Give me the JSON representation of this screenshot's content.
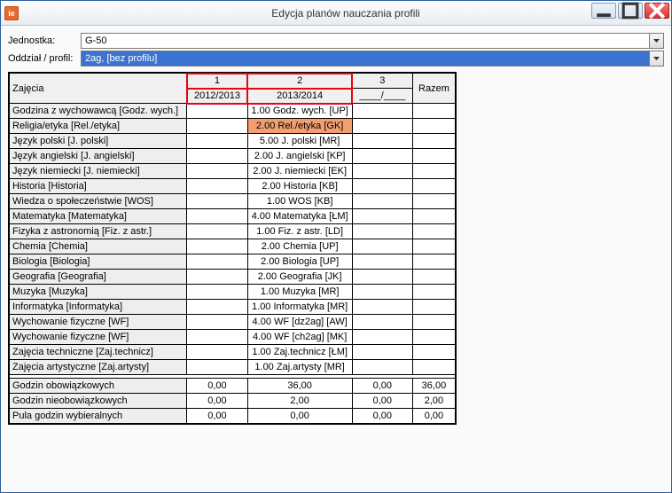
{
  "window": {
    "title": "Edycja planów nauczania profili",
    "icon_glyph": "ie"
  },
  "form": {
    "unit_label": "Jednostka:",
    "unit_value": "G-50",
    "profile_label": "Oddział / profil:",
    "profile_value": "2ag, [bez profilu]"
  },
  "table": {
    "header": {
      "subjects": "Zajęcia",
      "cols": [
        {
          "num": "1",
          "year": "2012/2013"
        },
        {
          "num": "2",
          "year": "2013/2014"
        },
        {
          "num": "3",
          "year": "____/____"
        }
      ],
      "total": "Razem"
    },
    "rows": [
      {
        "label": "Godzina z wychowawcą [Godz. wych.]",
        "c1": "",
        "c2": "1.00 Godz. wych. [UP]",
        "c3": "",
        "c4": ""
      },
      {
        "label": "Religia/etyka [Rel./etyka]",
        "c1": "",
        "c2": "2.00 Rel./etyka [GK]",
        "c3": "",
        "c4": "",
        "hl": true
      },
      {
        "label": "Język polski [J. polski]",
        "c1": "",
        "c2": "5.00 J. polski [MR]",
        "c3": "",
        "c4": ""
      },
      {
        "label": "Język angielski [J. angielski]",
        "c1": "",
        "c2": "2.00 J. angielski [KP]",
        "c3": "",
        "c4": ""
      },
      {
        "label": "Język niemiecki [J. niemiecki]",
        "c1": "",
        "c2": "2.00 J. niemiecki [EK]",
        "c3": "",
        "c4": ""
      },
      {
        "label": "Historia [Historia]",
        "c1": "",
        "c2": "2.00 Historia [KB]",
        "c3": "",
        "c4": ""
      },
      {
        "label": "Wiedza o społeczeństwie [WOS]",
        "c1": "",
        "c2": "1.00 WOS [KB]",
        "c3": "",
        "c4": ""
      },
      {
        "label": "Matematyka [Matematyka]",
        "c1": "",
        "c2": "4.00 Matematyka [ŁM]",
        "c3": "",
        "c4": ""
      },
      {
        "label": "Fizyka z astronomią [Fiz. z astr.]",
        "c1": "",
        "c2": "1.00 Fiz. z astr. [LD]",
        "c3": "",
        "c4": ""
      },
      {
        "label": "Chemia [Chemia]",
        "c1": "",
        "c2": "2.00 Chemia [UP]",
        "c3": "",
        "c4": ""
      },
      {
        "label": "Biologia [Biologia]",
        "c1": "",
        "c2": "2.00 Biologia [UP]",
        "c3": "",
        "c4": ""
      },
      {
        "label": "Geografia [Geografia]",
        "c1": "",
        "c2": "2.00 Geografia [JK]",
        "c3": "",
        "c4": ""
      },
      {
        "label": "Muzyka [Muzyka]",
        "c1": "",
        "c2": "1.00 Muzyka [MR]",
        "c3": "",
        "c4": ""
      },
      {
        "label": "Informatyka [Informatyka]",
        "c1": "",
        "c2": "1.00 Informatyka [MR]",
        "c3": "",
        "c4": ""
      },
      {
        "label": "Wychowanie fizyczne [WF]",
        "c1": "",
        "c2": "4.00 WF [dz2ag] [AW]",
        "c3": "",
        "c4": ""
      },
      {
        "label": "Wychowanie fizyczne [WF]",
        "c1": "",
        "c2": "4.00 WF [ch2ag] [MK]",
        "c3": "",
        "c4": ""
      },
      {
        "label": "Zajęcia techniczne [Zaj.technicz]",
        "c1": "",
        "c2": "1.00 Zaj.technicz [ŁM]",
        "c3": "",
        "c4": ""
      },
      {
        "label": "Zajęcia artystyczne [Zaj.artysty]",
        "c1": "",
        "c2": "1.00 Zaj.artysty [MR]",
        "c3": "",
        "c4": ""
      }
    ],
    "totals": [
      {
        "label": "Godzin obowiązkowych",
        "c1": "0,00",
        "c2": "36,00",
        "c3": "0,00",
        "c4": "36,00"
      },
      {
        "label": "Godzin nieobowiązkowych",
        "c1": "0,00",
        "c2": "2,00",
        "c3": "0,00",
        "c4": "2,00"
      },
      {
        "label": "Pula godzin wybieralnych",
        "c1": "0,00",
        "c2": "0,00",
        "c3": "0,00",
        "c4": "0,00"
      }
    ]
  }
}
